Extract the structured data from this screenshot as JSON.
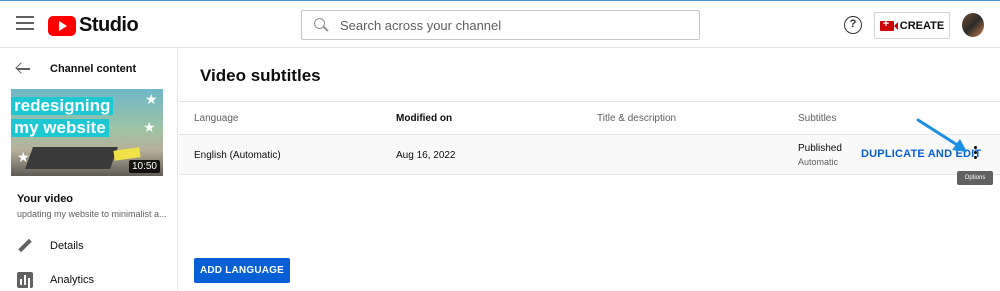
{
  "header": {
    "logo_text": "Studio",
    "search_placeholder": "Search across your channel",
    "help_symbol": "?",
    "create_label": "CREATE"
  },
  "sidebar": {
    "back_label": "Channel content",
    "thumbnail": {
      "line1": "redesigning",
      "line2": "my website",
      "duration": "10:50"
    },
    "your_video_label": "Your video",
    "video_title": "updating my website to minimalist a...",
    "nav": [
      {
        "label": "Details",
        "icon": "pencil-icon"
      },
      {
        "label": "Analytics",
        "icon": "analytics-icon"
      }
    ]
  },
  "main": {
    "title": "Video subtitles",
    "columns": [
      "Language",
      "Modified on",
      "Title & description",
      "Subtitles"
    ],
    "rows": [
      {
        "language": "English (Automatic)",
        "modified": "Aug 16, 2022",
        "title_description": "",
        "subtitles_status": "Published",
        "subtitles_type": "Automatic",
        "action": "DUPLICATE AND EDIT"
      }
    ],
    "tooltip": "Options",
    "add_language_label": "ADD LANGUAGE"
  },
  "colors": {
    "accent_blue": "#065fd4",
    "brand_red": "#ff0000",
    "annotation_arrow": "#1a8fe3"
  }
}
